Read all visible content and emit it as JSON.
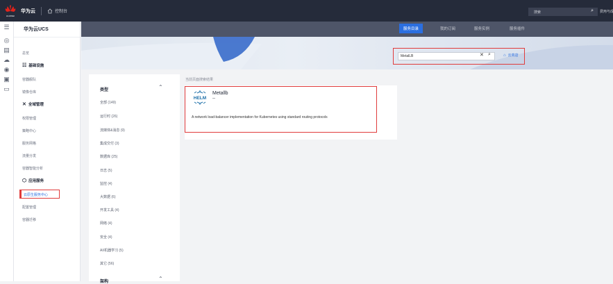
{
  "topbar": {
    "brand_logo_text": "HUAWEI",
    "brand": "华为云",
    "console": "控制台",
    "search_placeholder": "搜索",
    "more": "费用与成本"
  },
  "nav": {
    "title": "华为云UCS",
    "items": [
      {
        "label": "总览"
      },
      {
        "label": "基础设施",
        "group": true
      },
      {
        "label": "容器舰队"
      },
      {
        "label": "镜像仓库"
      },
      {
        "label": "全域管理",
        "group": true
      },
      {
        "label": "权限管理"
      },
      {
        "label": "策略中心"
      },
      {
        "label": "服务网格"
      },
      {
        "label": "流量分发"
      },
      {
        "label": "容器智能分析"
      },
      {
        "label": "应用服务",
        "group": true
      },
      {
        "label": "云原生服务中心",
        "active": true
      },
      {
        "label": "配置管理"
      },
      {
        "label": "容器迁移"
      }
    ]
  },
  "tabs": [
    {
      "label": "服务目录",
      "active": true
    },
    {
      "label": "我的订阅"
    },
    {
      "label": "服务实例"
    },
    {
      "label": "服务插件"
    }
  ],
  "search": {
    "value": "MetalLB",
    "store_label": "云商店"
  },
  "filters": {
    "category_title": "类型",
    "items": [
      "全部 (149)",
      "运行时 (26)",
      "流媒体&消息 (9)",
      "集成交付 (3)",
      "数据库 (25)",
      "日志 (5)",
      "监控 (4)",
      "大数据 (6)",
      "开发工具 (4)",
      "网络 (4)",
      "安全 (4)",
      "AI/机器学习 (5)",
      "其它 (56)"
    ],
    "second_title": "架构"
  },
  "results": {
    "note": "当前页面搜索结果",
    "card": {
      "name": "Metallb",
      "subtitle": "--",
      "description": "A network load-balancer implementation for Kubernetes using standard routing protocols"
    }
  },
  "colors": {
    "topbar": "#252b3a",
    "accent": "#2b6fe0",
    "highlight": "#e03b3b"
  }
}
